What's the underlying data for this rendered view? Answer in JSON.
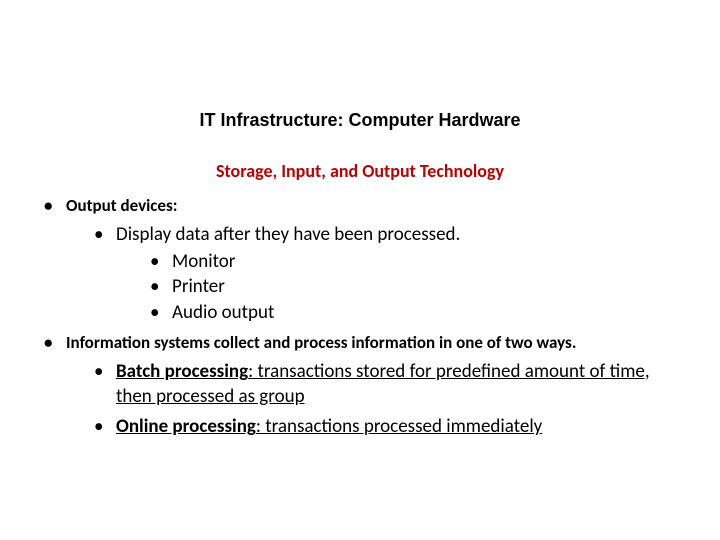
{
  "title": "IT Infrastructure: Computer Hardware",
  "subtitle": "Storage, Input, and Output Technology",
  "bullets": {
    "l1a": "Output devices:",
    "l2a": "Display data after they have been processed.",
    "l3a": "Monitor",
    "l3b": "Printer",
    "l3c": "Audio output",
    "l1b": "Information systems collect and process information in one of two ways.",
    "l2b_term": "Batch processing",
    "l2b_rest": ": transactions stored for predefined amount of time, then processed as group",
    "l2c_term": "Online processing",
    "l2c_rest": ": transactions processed immediately"
  }
}
